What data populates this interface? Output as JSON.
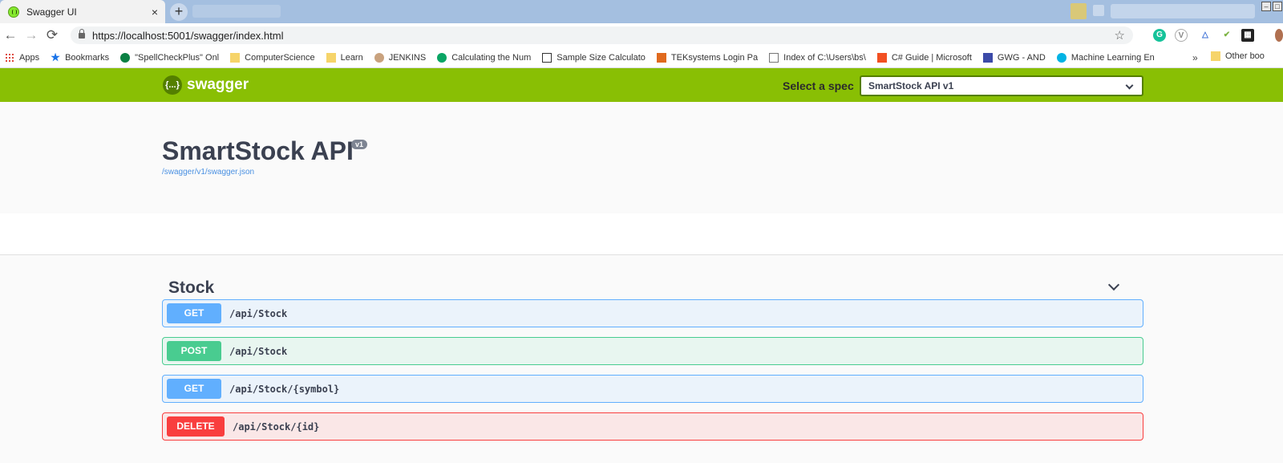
{
  "browser": {
    "tab_title": "Swagger UI",
    "tab_close": "×",
    "new_tab": "+",
    "url_text": "https://localhost:5001/swagger/index.html",
    "back": "←",
    "forward": "→",
    "reload": "⟳",
    "star": "☆",
    "bookmarks": [
      {
        "label": "Apps",
        "icon": "apps-grid-icon",
        "color": "#d93025"
      },
      {
        "label": "Bookmarks",
        "icon": "star-icon",
        "color": "#1a73e8"
      },
      {
        "label": "\"SpellCheckPlus\" Onl",
        "icon": "checkmark-icon",
        "color": "#0b8043"
      },
      {
        "label": "ComputerScience",
        "icon": "folder-icon",
        "color": "#f6d46a"
      },
      {
        "label": "Learn",
        "icon": "folder-icon",
        "color": "#f6d46a"
      },
      {
        "label": "JENKINS",
        "icon": "jenkins-icon",
        "color": "#c9a27e"
      },
      {
        "label": "Calculating the Num",
        "icon": "calc-icon",
        "color": "#0aa564"
      },
      {
        "label": "Sample Size Calculato",
        "icon": "download-icon",
        "color": "#333333"
      },
      {
        "label": "TEKsystems Login Pa",
        "icon": "teksystems-icon",
        "color": "#e06a1e"
      },
      {
        "label": "Index of C:\\Users\\bs\\",
        "icon": "file-icon",
        "color": "#777777"
      },
      {
        "label": "C# Guide | Microsoft",
        "icon": "microsoft-icon",
        "color": "#f25022"
      },
      {
        "label": "GWG - AND",
        "icon": "gwg-icon",
        "color": "#3c4aa8"
      },
      {
        "label": "Machine Learning En",
        "icon": "udacity-icon",
        "color": "#02b3e4"
      }
    ],
    "bookmarks_more": "»",
    "other_bookmarks": "Other boo"
  },
  "swagger": {
    "logo_text": "swagger",
    "logo_mark": "{...}",
    "spec_label": "Select a spec",
    "spec_selected": "SmartStock API v1",
    "api_title": "SmartStock API",
    "version_badge": "v1",
    "spec_link": "/swagger/v1/swagger.json",
    "tag_name": "Stock",
    "operations": [
      {
        "method": "GET",
        "path": "/api/Stock",
        "kind": "get"
      },
      {
        "method": "POST",
        "path": "/api/Stock",
        "kind": "post"
      },
      {
        "method": "GET",
        "path": "/api/Stock/{symbol}",
        "kind": "get"
      },
      {
        "method": "DELETE",
        "path": "/api/Stock/{id}",
        "kind": "delete"
      }
    ]
  },
  "colors": {
    "topbar": "#89bf04",
    "get": "#61affe",
    "post": "#49cc90",
    "delete": "#f93e3e"
  }
}
